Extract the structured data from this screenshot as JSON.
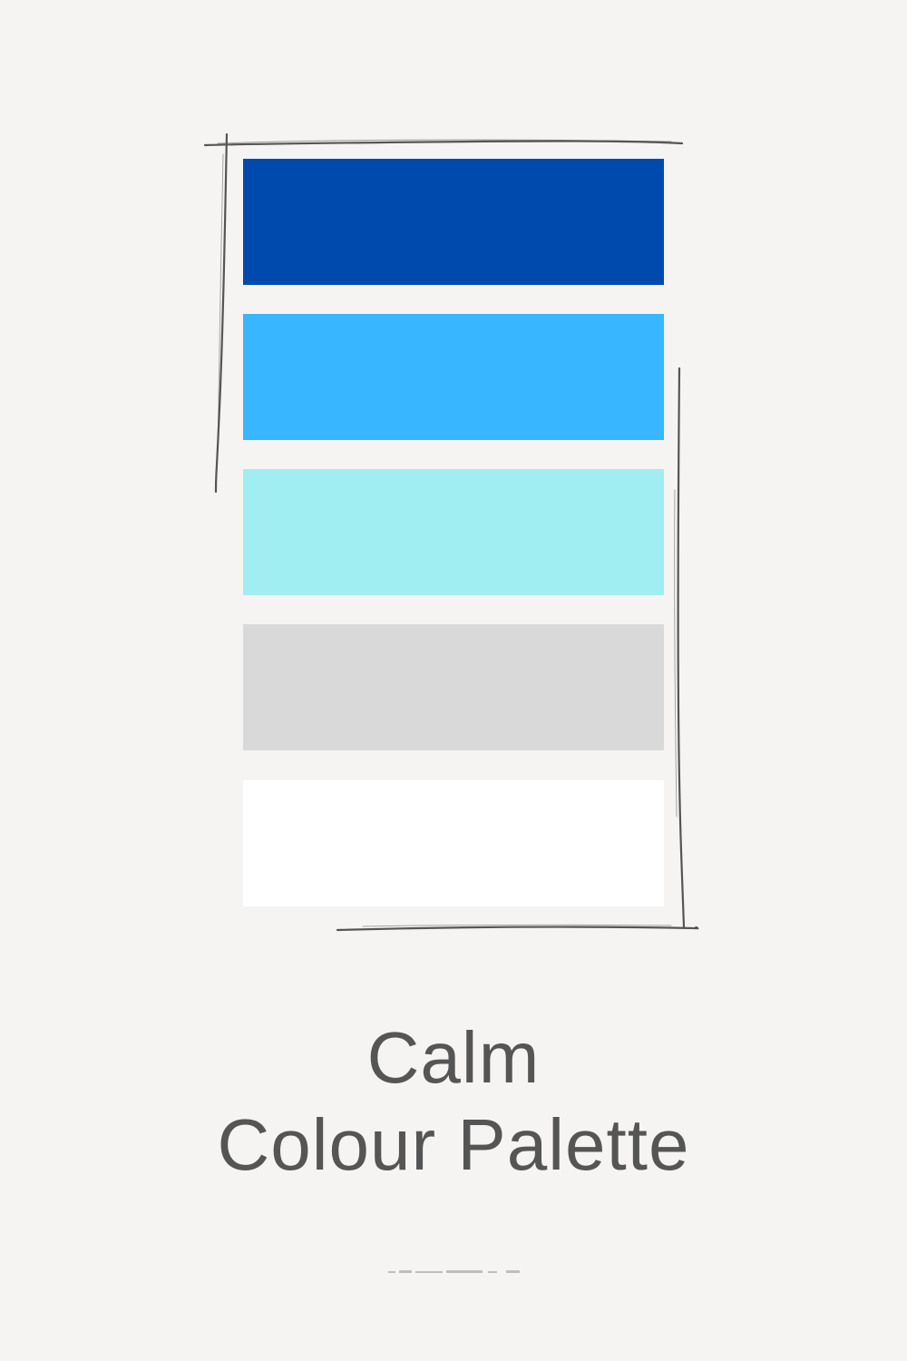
{
  "palette": {
    "swatches": [
      {
        "name": "deep-blue",
        "color": "#004aad"
      },
      {
        "name": "sky-blue",
        "color": "#38b6ff"
      },
      {
        "name": "aqua",
        "color": "#a1eef2"
      },
      {
        "name": "light-grey",
        "color": "#d9d9d9"
      },
      {
        "name": "white",
        "color": "#ffffff"
      }
    ],
    "frame_color": "#555555",
    "background": "#f5f4f2"
  },
  "title": {
    "line1": "Calm",
    "line2": "Colour Palette",
    "color": "#555555"
  }
}
